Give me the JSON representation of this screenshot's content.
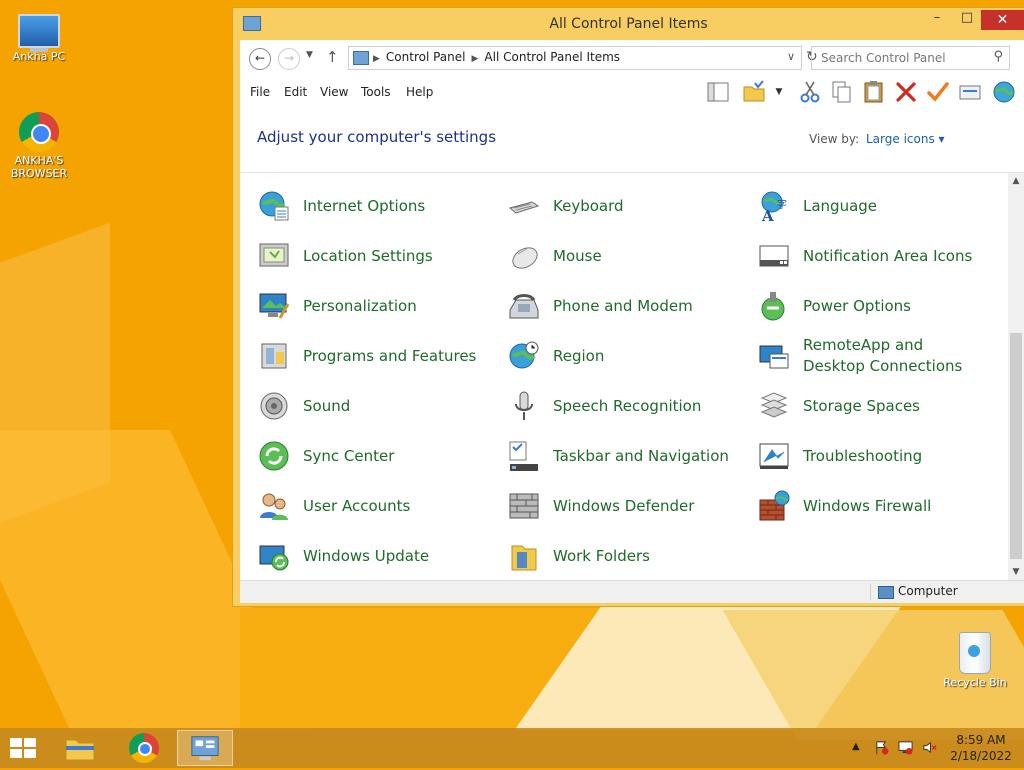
{
  "desktop": {
    "icons": [
      {
        "label": "Ankha PC"
      },
      {
        "label": "ANKHA'S BROWSER"
      },
      {
        "label": "Recycle Bin"
      }
    ]
  },
  "window": {
    "title": "All Control Panel Items",
    "controls": {
      "minimize": "–",
      "maximize": "□",
      "close": "✕"
    }
  },
  "address": {
    "crumbs": [
      "Control Panel",
      "All Control Panel Items"
    ],
    "search_placeholder": "Search Control Panel"
  },
  "menu": [
    "File",
    "Edit",
    "View",
    "Tools",
    "Help"
  ],
  "header": {
    "title": "Adjust your computer's settings",
    "view_by_label": "View by:",
    "view_by_value": "Large icons ▾"
  },
  "items": [
    {
      "label": "Internet Options",
      "icon": "internet-options-icon"
    },
    {
      "label": "Keyboard",
      "icon": "keyboard-icon"
    },
    {
      "label": "Language",
      "icon": "language-icon"
    },
    {
      "label": "Location Settings",
      "icon": "location-settings-icon"
    },
    {
      "label": "Mouse",
      "icon": "mouse-icon"
    },
    {
      "label": "Notification Area Icons",
      "icon": "notification-area-icon"
    },
    {
      "label": "Personalization",
      "icon": "personalization-icon"
    },
    {
      "label": "Phone and Modem",
      "icon": "phone-modem-icon"
    },
    {
      "label": "Power Options",
      "icon": "power-options-icon"
    },
    {
      "label": "Programs and Features",
      "icon": "programs-features-icon"
    },
    {
      "label": "Region",
      "icon": "region-icon"
    },
    {
      "label": "RemoteApp and Desktop Connections",
      "icon": "remoteapp-icon"
    },
    {
      "label": "Sound",
      "icon": "sound-icon"
    },
    {
      "label": "Speech Recognition",
      "icon": "speech-recognition-icon"
    },
    {
      "label": "Storage Spaces",
      "icon": "storage-spaces-icon"
    },
    {
      "label": "Sync Center",
      "icon": "sync-center-icon"
    },
    {
      "label": "Taskbar and Navigation",
      "icon": "taskbar-navigation-icon"
    },
    {
      "label": "Troubleshooting",
      "icon": "troubleshooting-icon"
    },
    {
      "label": "User Accounts",
      "icon": "user-accounts-icon"
    },
    {
      "label": "Windows Defender",
      "icon": "windows-defender-icon"
    },
    {
      "label": "Windows Firewall",
      "icon": "windows-firewall-icon"
    },
    {
      "label": "Windows Update",
      "icon": "windows-update-icon"
    },
    {
      "label": "Work Folders",
      "icon": "work-folders-icon"
    }
  ],
  "status": {
    "location": "Computer"
  },
  "taskbar": {
    "apps": [
      {
        "name": "File Explorer",
        "icon": "file-explorer-icon"
      },
      {
        "name": "Google Chrome",
        "icon": "chrome-icon"
      },
      {
        "name": "Control Panel",
        "icon": "control-panel-icon",
        "active": true
      }
    ],
    "clock_time": "8:59 AM",
    "clock_date": "2/18/2022"
  },
  "colors": {
    "item_link": "#1e6b2a",
    "heading": "#1e3287",
    "accent_link": "#1a5fb4",
    "window_frame": "#f8ce62",
    "close_button": "#c7312b",
    "desktop": "#f5a300"
  }
}
